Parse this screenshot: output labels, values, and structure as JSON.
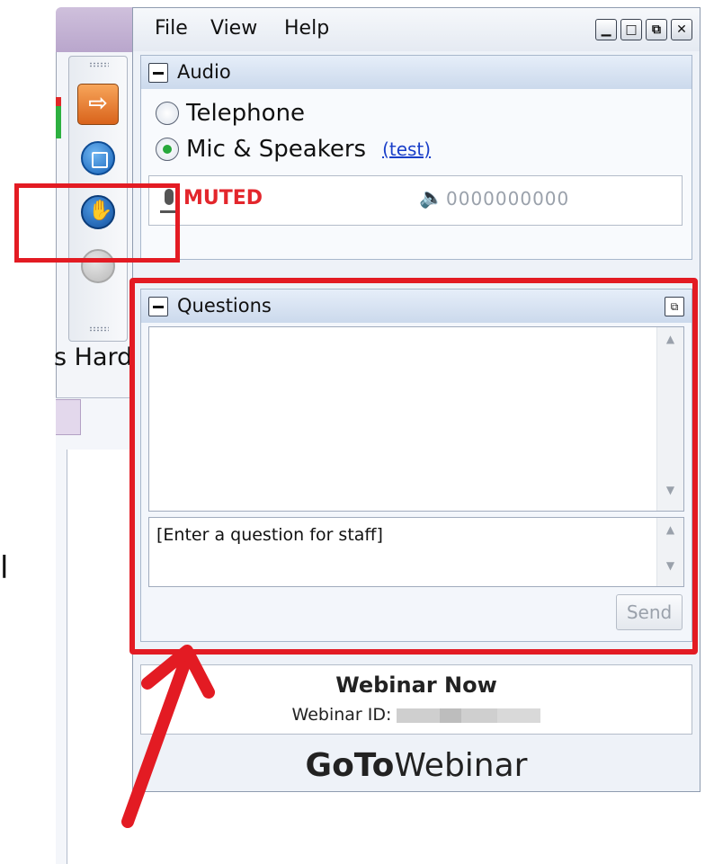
{
  "menu": {
    "file": "File",
    "view": "View",
    "help": "Help"
  },
  "window_controls": {
    "minimize": "▁",
    "maximize": "□",
    "restore": "⧉",
    "close": "✕"
  },
  "audio": {
    "title": "Audio",
    "options": [
      {
        "label": "Telephone",
        "selected": false
      },
      {
        "label": "Mic & Speakers",
        "selected": true
      }
    ],
    "test_link": "(test)",
    "status": "MUTED",
    "level_meter": "0000000000"
  },
  "questions": {
    "title": "Questions",
    "input_text": "[Enter a question for staff]",
    "send_label": "Send"
  },
  "webinar": {
    "name": "Webinar Now",
    "id_label": "Webinar ID:"
  },
  "brand": {
    "bold": "GoTo",
    "light": "Webinar"
  },
  "background": {
    "partial_text": "s Hard",
    "edge_glyph": "l"
  },
  "icons": [
    "arrow-right-icon",
    "screen-circle-icon",
    "raise-hand-icon",
    "disabled-circle-icon",
    "microphone-icon",
    "speaker-icon",
    "popout-icon"
  ],
  "colors": {
    "annotation_red": "#e31b23",
    "muted_red": "#e3262c",
    "link_blue": "#1a3fc9",
    "radio_green": "#27a83b"
  }
}
